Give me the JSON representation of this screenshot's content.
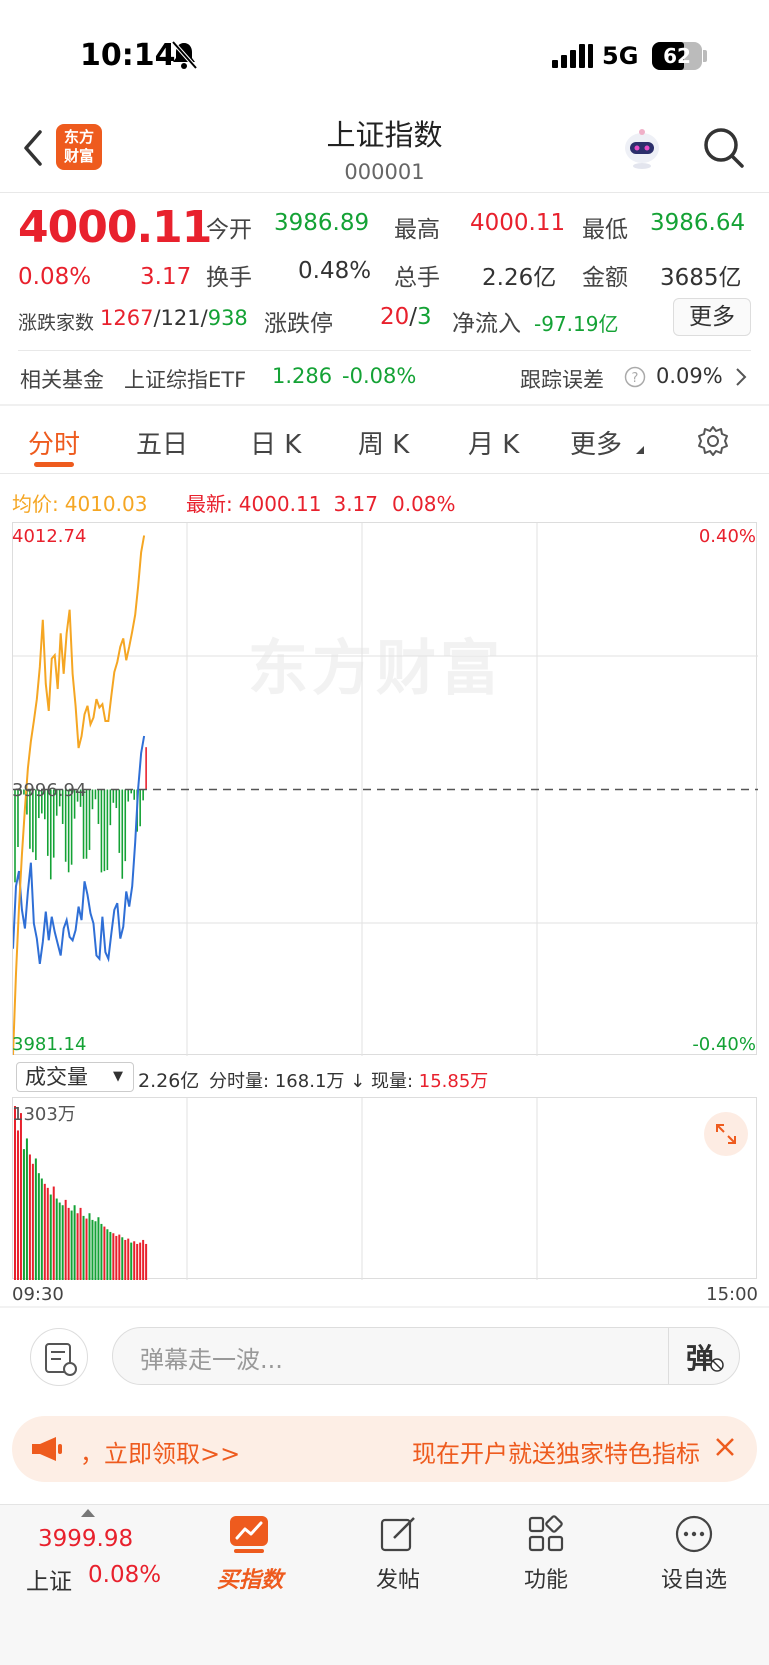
{
  "status": {
    "time": "10:14",
    "network": "5G",
    "battery": "62"
  },
  "header": {
    "title": "上证指数",
    "code": "000001",
    "logo_text": "东方\n财富"
  },
  "quote": {
    "price": "4000.11",
    "change_pct": "0.08%",
    "change": "3.17",
    "open_label": "今开",
    "open": "3986.89",
    "high_label": "最高",
    "high": "4000.11",
    "low_label": "最低",
    "low": "3986.64",
    "turnover_label": "换手",
    "turnover": "0.48%",
    "volume_label": "总手",
    "volume": "2.26亿",
    "amount_label": "金额",
    "amount": "3685亿",
    "breadth_label": "涨跌家数",
    "breadth_up": "1267",
    "breadth_flat": "121",
    "breadth_down": "938",
    "limit_label": "涨跌停",
    "limit_up": "20",
    "limit_down": "3",
    "netflow_label": "净流入",
    "netflow": "-97.19亿",
    "more_label": "更多"
  },
  "fund": {
    "label": "相关基金",
    "name": "上证综指ETF",
    "price": "1.286",
    "change": "-0.08%",
    "error_label": "跟踪误差",
    "error": "0.09%"
  },
  "tabs": [
    "分时",
    "五日",
    "日 K",
    "周 K",
    "月 K",
    "更多"
  ],
  "legend": {
    "avg_label": "均价:",
    "avg": "4010.03",
    "latest_label": "最新:",
    "latest": "4000.11",
    "latest_chg": "3.17",
    "latest_pct": "0.08%"
  },
  "chart_labels": {
    "y_max": "4012.74",
    "y_mid": "3996.94",
    "y_min": "3981.14",
    "pct_max": "0.40%",
    "pct_min": "-0.40%",
    "watermark": "东方财富"
  },
  "volume": {
    "select": "成交量",
    "total": "2.26亿",
    "minute_label": "分时量:",
    "minute": "168.1万",
    "arrow": "↓",
    "now_label": "现量:",
    "now": "15.85万",
    "max": "1303万",
    "time_start": "09:30",
    "time_end": "15:00"
  },
  "comment": {
    "placeholder": "弹幕走一波...",
    "danmu_btn": "弹"
  },
  "promo": {
    "sep": "，",
    "claim": "立即领取>>",
    "text": "现在开户就送独家特色指标"
  },
  "nav": {
    "ticker_price": "3999.98",
    "ticker_name": "上证",
    "ticker_pct": "0.08%",
    "buy": "买指数",
    "post": "发帖",
    "func": "功能",
    "watch": "设自选"
  },
  "chart_data": {
    "type": "line",
    "title": "",
    "ylim": [
      3981.14,
      4012.74
    ],
    "series": [
      {
        "name": "最新",
        "color": "#2f6fd6",
        "values": [
          3987.5,
          3991.2,
          3992.1,
          3989.8,
          3988.7,
          3990.9,
          3992.6,
          3989.0,
          3988.1,
          3986.6,
          3987.9,
          3989.7,
          3988.0,
          3989.4,
          3988.5,
          3987.8,
          3987.1,
          3988.7,
          3989.2,
          3988.2,
          3988.0,
          3988.6,
          3990.0,
          3989.2,
          3991.5,
          3990.7,
          3989.6,
          3989.0,
          3987.1,
          3986.9,
          3989.4,
          3987.3,
          3986.9,
          3988.4,
          3989.8,
          3990.2,
          3988.1,
          3988.8,
          3990.9,
          3990.0,
          3991.2,
          3993.8,
          3997.0,
          3999.1,
          4000.11
        ]
      },
      {
        "name": "均价",
        "color": "#f5a623",
        "values": [
          3981.2,
          3986.0,
          3989.9,
          3993.1,
          3995.8,
          3998.2,
          3999.8,
          4001.0,
          4002.3,
          4004.2,
          4007.0,
          4003.2,
          4001.6,
          4004.7,
          4004.9,
          4002.9,
          4006.2,
          4003.8,
          4006.2,
          4007.6,
          4003.8,
          4001.9,
          3999.4,
          4000.1,
          4001.4,
          4001.9,
          4000.8,
          4001.2,
          4002.3,
          4001.8,
          4002.0,
          4001.0,
          4001.0,
          4002.5,
          4003.9,
          4004.5,
          4005.4,
          4005.9,
          4004.6,
          4005.4,
          4006.3,
          4007.3,
          4009.0,
          4011.0,
          4012.0
        ]
      }
    ],
    "volume_bars": [
      1303,
      1120,
      1250,
      980,
      1060,
      940,
      870,
      910,
      800,
      760,
      720,
      690,
      640,
      700,
      610,
      580,
      560,
      600,
      540,
      520,
      560,
      500,
      540,
      480,
      460,
      500,
      450,
      440,
      470,
      420,
      400,
      380,
      360,
      350,
      330,
      340,
      320,
      300,
      310,
      280,
      290,
      270,
      280,
      300,
      270
    ],
    "volume_max": 1303,
    "x_range": [
      "09:30",
      "15:00"
    ]
  }
}
